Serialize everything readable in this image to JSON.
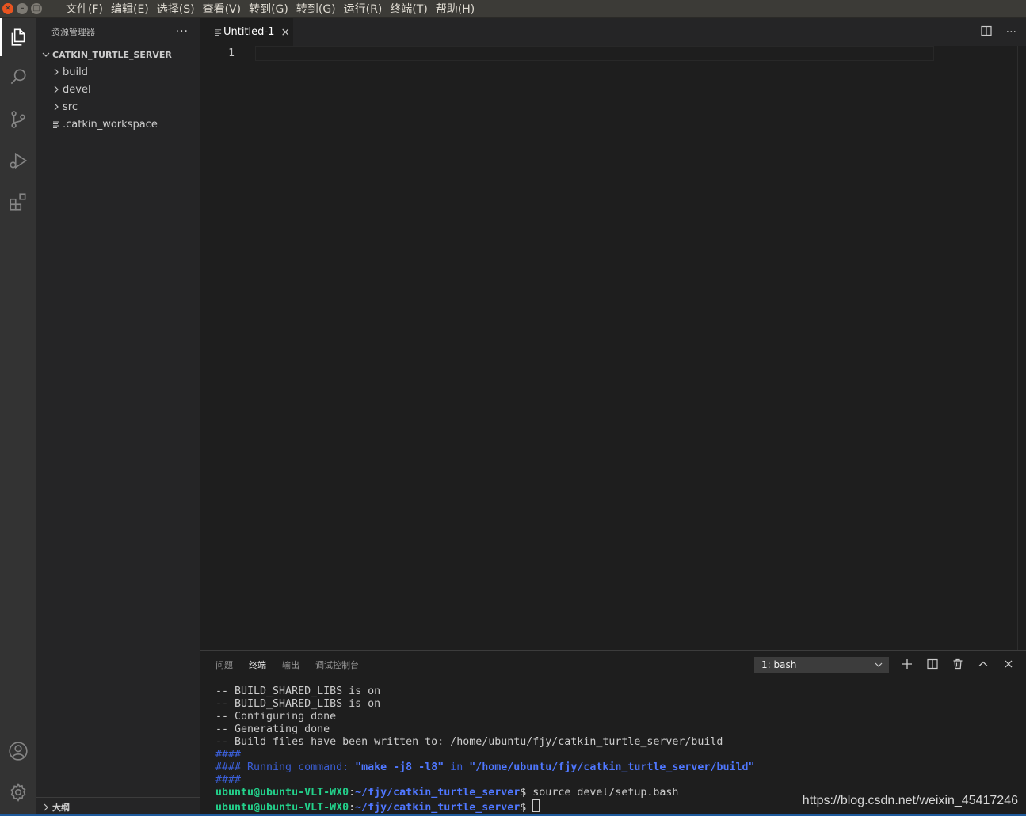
{
  "window": {
    "close_glyph": "×",
    "min_glyph": "–",
    "max_glyph": "□"
  },
  "menu": [
    "文件(F)",
    "编辑(E)",
    "选择(S)",
    "查看(V)",
    "转到(G)",
    "转到(G)",
    "运行(R)",
    "终端(T)",
    "帮助(H)"
  ],
  "activity_bar": {
    "items": [
      "explorer-icon",
      "search-icon",
      "source-control-icon",
      "run-debug-icon",
      "extensions-icon"
    ],
    "bottom": [
      "account-icon",
      "settings-gear-icon"
    ],
    "active": "explorer-icon"
  },
  "sidebar": {
    "title": "资源管理器",
    "more": "···",
    "root": "CATKIN_TURTLE_SERVER",
    "items": [
      {
        "label": "build",
        "type": "folder"
      },
      {
        "label": "devel",
        "type": "folder"
      },
      {
        "label": "src",
        "type": "folder"
      },
      {
        "label": ".catkin_workspace",
        "type": "file"
      }
    ],
    "outline_label": "大纲"
  },
  "editor": {
    "tab_label": "Untitled-1",
    "tab_close": "×",
    "line_numbers": [
      "1"
    ]
  },
  "panel": {
    "tabs": [
      "问题",
      "终端",
      "输出",
      "调试控制台"
    ],
    "active_tab": "终端",
    "terminal_select": "1: bash",
    "terminal": {
      "lines": [
        "-- BUILD_SHARED_LIBS is on",
        "-- BUILD_SHARED_LIBS is on",
        "-- Configuring done",
        "-- Generating done",
        "-- Build files have been written to: /home/ubuntu/fjy/catkin_turtle_server/build"
      ],
      "hash1": "####",
      "run_prefix": "#### Running command: ",
      "run_cmd": "\"make -j8 -l8\"",
      "run_in": " in ",
      "run_path": "\"/home/ubuntu/fjy/catkin_turtle_server/build\"",
      "hash2": "####",
      "prompt_user": "ubuntu@ubuntu-VLT-WX0",
      "prompt_colon": ":",
      "prompt_path": "~/fjy/catkin_turtle_server",
      "prompt_dollar": "$ ",
      "cmd1": "source devel/setup.bash",
      "cmd2": ""
    }
  },
  "watermark": "https://blog.csdn.net/weixin_45417246",
  "colors": {
    "accent": "#e95420",
    "terminal_green": "#23d18b",
    "terminal_blue": "#4f77ff"
  }
}
